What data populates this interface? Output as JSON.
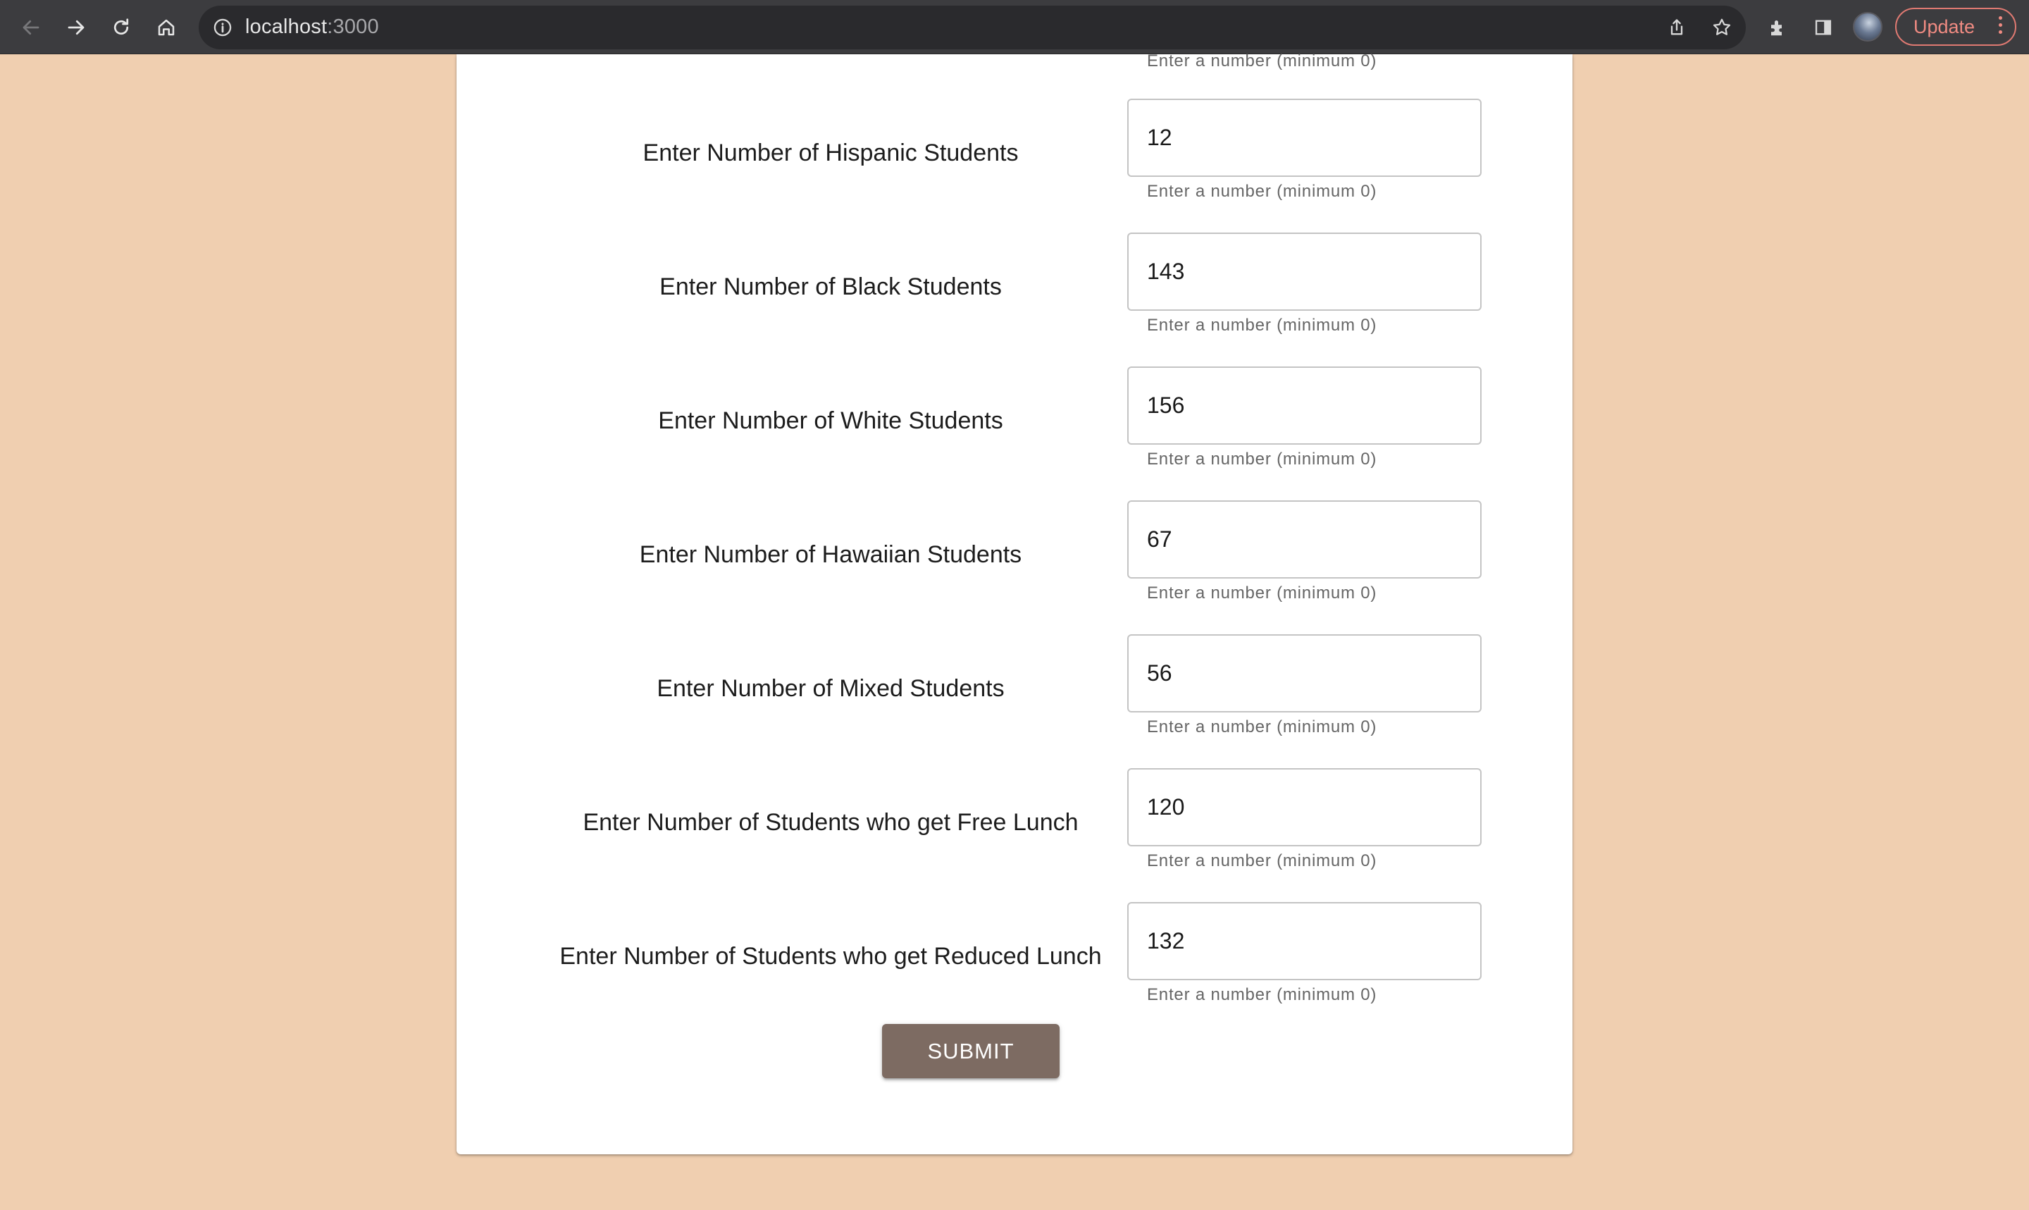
{
  "browser": {
    "url_host": "localhost",
    "url_port": ":3000",
    "update_label": "Update",
    "icons": [
      "back-arrow-icon",
      "forward-arrow-icon",
      "reload-icon",
      "home-icon",
      "info-icon",
      "share-icon",
      "star-icon",
      "extensions-icon",
      "side-panel-icon",
      "profile-avatar",
      "kebab-menu-icon"
    ]
  },
  "form": {
    "top_helper": "Enter a number (minimum 0)",
    "rows": [
      {
        "label": "Enter Number of Hispanic Students",
        "value": "12",
        "helper": "Enter a number (minimum 0)"
      },
      {
        "label": "Enter Number of Black Students",
        "value": "143",
        "helper": "Enter a number (minimum 0)"
      },
      {
        "label": "Enter Number of White Students",
        "value": "156",
        "helper": "Enter a number (minimum 0)"
      },
      {
        "label": "Enter Number of Hawaiian Students",
        "value": "67",
        "helper": "Enter a number (minimum 0)"
      },
      {
        "label": "Enter Number of Mixed Students",
        "value": "56",
        "helper": "Enter a number (minimum 0)"
      },
      {
        "label": "Enter Number of Students who get Free Lunch",
        "value": "120",
        "helper": "Enter a number (minimum 0)"
      },
      {
        "label": "Enter Number of Students who get Reduced Lunch",
        "value": "132",
        "helper": "Enter a number (minimum 0)"
      }
    ],
    "submit_label": "SUBMIT"
  },
  "colors": {
    "page_background": "#f0cfb0",
    "submit_button": "#7d6b62",
    "update_accent": "#f08b82"
  }
}
